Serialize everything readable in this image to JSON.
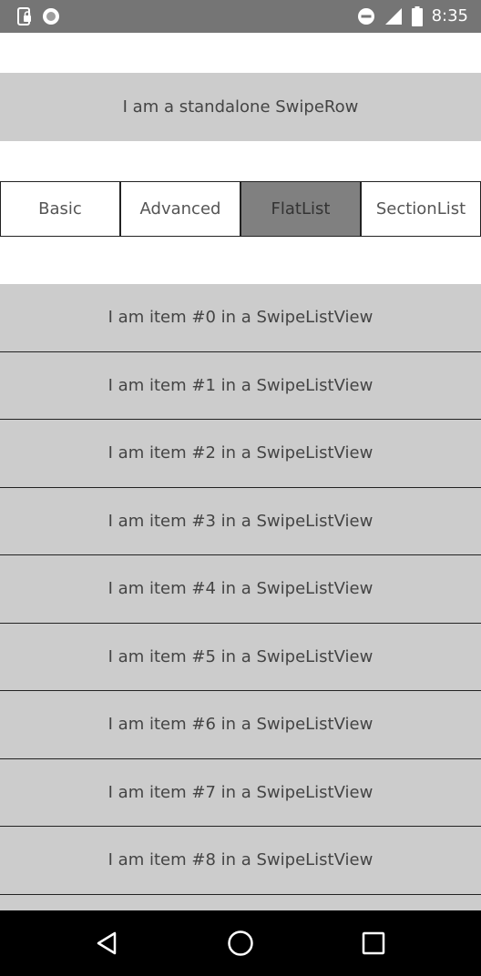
{
  "status_bar": {
    "time": "8:35",
    "left_icons": [
      "phone-lock-icon",
      "circle-record-icon"
    ],
    "right_icons": [
      "do-not-disturb-icon",
      "signal-icon",
      "battery-icon"
    ]
  },
  "standalone_row": {
    "label": "I am a standalone SwipeRow"
  },
  "tabs": [
    {
      "label": "Basic",
      "active": false
    },
    {
      "label": "Advanced",
      "active": false
    },
    {
      "label": "FlatList",
      "active": true
    },
    {
      "label": "SectionList",
      "active": false
    }
  ],
  "list": {
    "items": [
      "I am item #0 in a SwipeListView",
      "I am item #1 in a SwipeListView",
      "I am item #2 in a SwipeListView",
      "I am item #3 in a SwipeListView",
      "I am item #4 in a SwipeListView",
      "I am item #5 in a SwipeListView",
      "I am item #6 in a SwipeListView",
      "I am item #7 in a SwipeListView",
      "I am item #8 in a SwipeListView"
    ]
  },
  "nav_bar": {
    "icons": [
      "back-icon",
      "home-icon",
      "recents-icon"
    ]
  },
  "colors": {
    "status_bar": "#757575",
    "row_bg": "#cccccc",
    "active_tab": "#808080",
    "nav_bar": "#000000"
  }
}
